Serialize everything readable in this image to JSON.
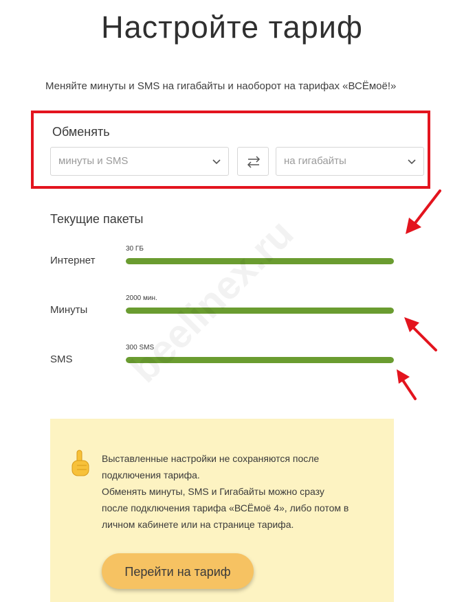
{
  "header": {
    "title": "Настройте тариф",
    "subtitle": "Меняйте минуты и SMS на гигабайты и наоборот на тарифах «ВСЁмоё!»"
  },
  "exchange": {
    "label": "Обменять",
    "from_select": {
      "value": "минуты и SMS",
      "icon": "chevron-down-icon"
    },
    "swap_icon": "swap-arrows-icon",
    "to_select": {
      "value": "на гигабайты",
      "icon": "chevron-down-icon"
    }
  },
  "packages": {
    "heading": "Текущие пакеты",
    "items": [
      {
        "label": "Интернет",
        "value": "30 ГБ",
        "fill": 1.0
      },
      {
        "label": "Минуты",
        "value": "2000 мин.",
        "fill": 1.0
      },
      {
        "label": "SMS",
        "value": "300 SMS",
        "fill": 1.0
      }
    ]
  },
  "notice": {
    "icon": "pointing-hand-icon",
    "lines": [
      "Выставленные настройки не сохраняются после",
      "подключения тарифа.",
      "Обменять минуты, SMS и Гигабайты можно сразу",
      "после подключения тарифа «ВСЁмоё 4», либо потом в",
      "личном кабинете или на странице тарифа."
    ],
    "button_label": "Перейти на тариф"
  },
  "watermark": "beelinex.ru",
  "colors": {
    "highlight_frame": "#e3141e",
    "bar_fill": "#6a9c30",
    "notice_bg": "#fdf3c2",
    "button_bg": "#f6c262",
    "arrow": "#e3141e"
  }
}
